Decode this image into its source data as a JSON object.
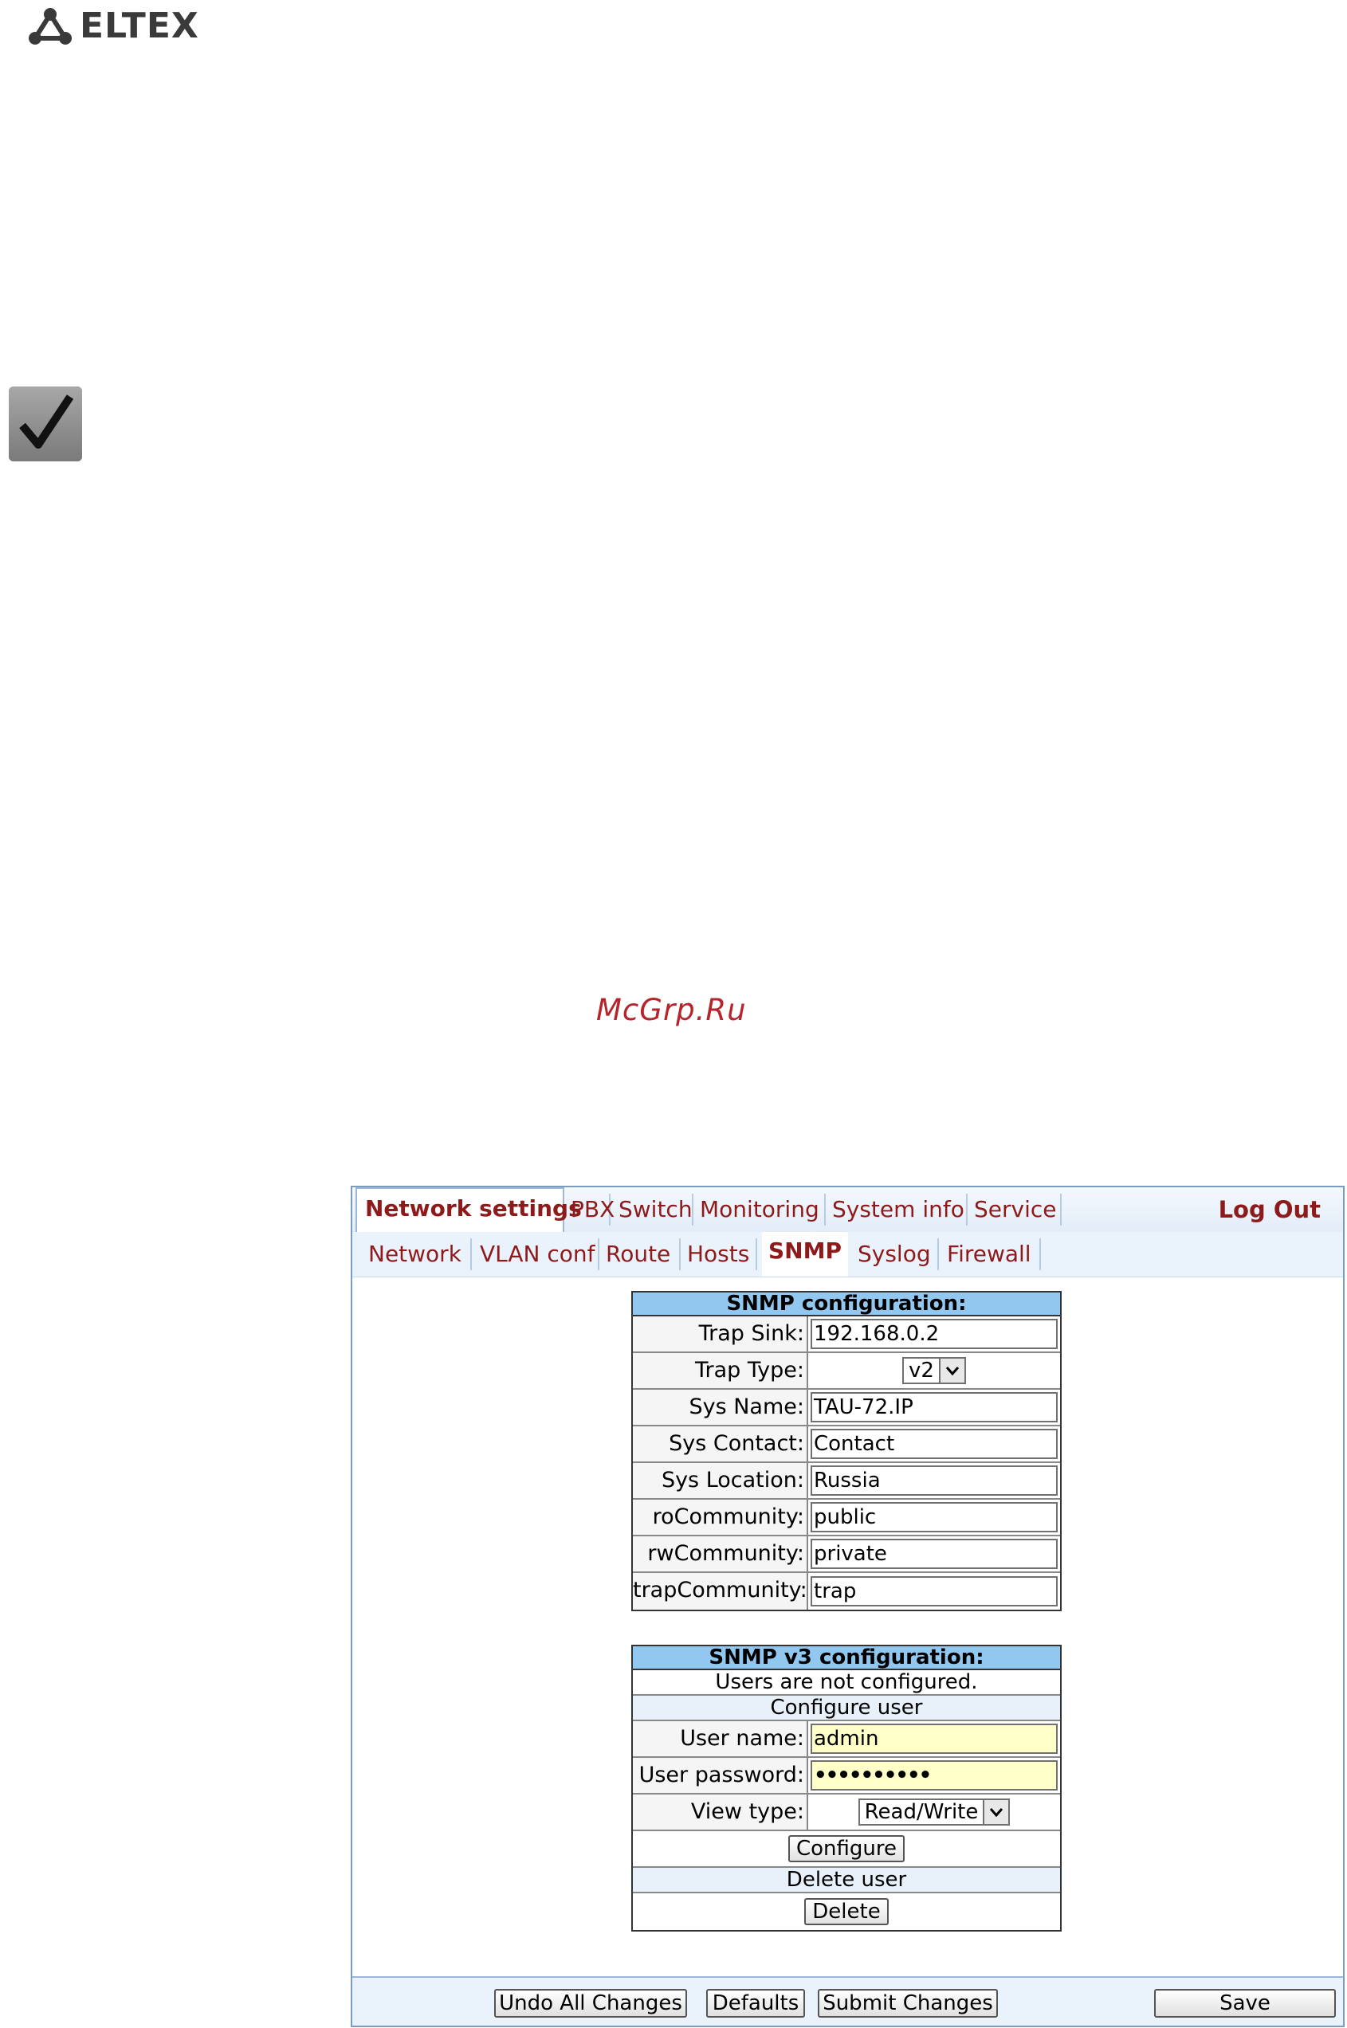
{
  "header": {
    "brand": "ELTEX"
  },
  "watermark": "McGrp.Ru",
  "top_tabs": [
    {
      "label": "Network settings",
      "active": true
    },
    {
      "label": "PBX"
    },
    {
      "label": "Switch"
    },
    {
      "label": "Monitoring"
    },
    {
      "label": "System info"
    },
    {
      "label": "Service"
    }
  ],
  "logout_label": "Log Out",
  "sub_tabs": [
    {
      "label": "Network"
    },
    {
      "label": "VLAN conf"
    },
    {
      "label": "Route"
    },
    {
      "label": "Hosts"
    },
    {
      "label": "SNMP",
      "active": true
    },
    {
      "label": "Syslog"
    },
    {
      "label": "Firewall"
    }
  ],
  "snmp": {
    "title": "SNMP configuration:",
    "trap_sink_label": "Trap Sink:",
    "trap_sink_value": "192.168.0.2",
    "trap_type_label": "Trap Type:",
    "trap_type_value": "v2",
    "sys_name_label": "Sys Name:",
    "sys_name_value": "TAU-72.IP",
    "sys_contact_label": "Sys Contact:",
    "sys_contact_value": "Contact",
    "sys_location_label": "Sys Location:",
    "sys_location_value": "Russia",
    "ro_label": "roCommunity:",
    "ro_value": "public",
    "rw_label": "rwCommunity:",
    "rw_value": "private",
    "trap_comm_label": "trapCommunity:",
    "trap_comm_value": "trap"
  },
  "snmp_v3": {
    "title": "SNMP v3 configuration:",
    "status": "Users are not configured.",
    "configure_header": "Configure user",
    "user_name_label": "User name:",
    "user_name_value": "admin",
    "user_password_label": "User password:",
    "user_password_value": "••••••••••",
    "view_type_label": "View type:",
    "view_type_value": "Read/Write",
    "configure_button": "Configure",
    "delete_header": "Delete user",
    "delete_button": "Delete"
  },
  "footer": {
    "undo": "Undo All Changes",
    "defaults": "Defaults",
    "submit": "Submit Changes",
    "save": "Save"
  },
  "colors": {
    "tab_text": "#8e1b1b",
    "header_fill": "#92c8f0",
    "watermark": "#b5252b"
  }
}
